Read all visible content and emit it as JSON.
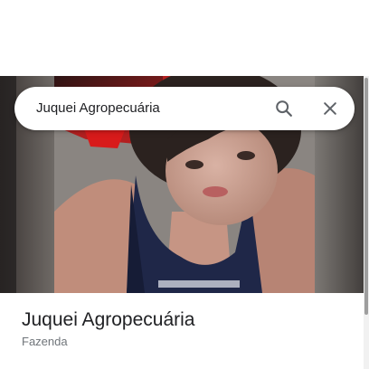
{
  "search": {
    "query": "Juquei Agropecuária"
  },
  "place": {
    "name": "Juquei Agropecuária",
    "category": "Fazenda"
  },
  "icons": {
    "search": "search-icon",
    "close": "close-icon"
  },
  "colors": {
    "text_primary": "#202124",
    "text_secondary": "#70757a",
    "icon": "#5f6368"
  }
}
